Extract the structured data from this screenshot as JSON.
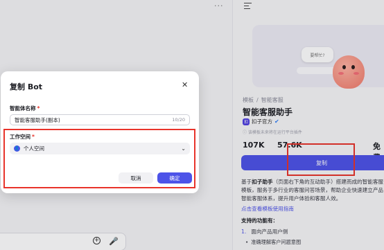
{
  "chat": {
    "more_icon": "more-horizontal-icon",
    "add_icon_label": "+",
    "mic_icon_label": "🎤"
  },
  "detail": {
    "preview_bubble": "要帮忙?",
    "breadcrumb": [
      "模板",
      "智能客服"
    ],
    "title": "智能客服助手",
    "author": "扣子官方",
    "author_logo": "扣",
    "notice": "该模板未来将在运行平台插件",
    "stats": [
      "107K",
      "57.6K",
      "免费"
    ],
    "copy_button": "复制",
    "description_prefix": "基于",
    "description_bold": "扣子助手",
    "description_rest": "（页面右下角的互动助手）搭建而成的智能客服模板，服务于多行业的客服问答场景，帮助企业快速建立产品智能客服体系，提升用户体验和客服人效。",
    "guide_link": "点击查看模板使用指南",
    "features_title": "支持的功能有：",
    "feature_1_num": "1.",
    "feature_1": "面向产品用户侧",
    "feature_1_sub": "准确理解客户问题意图"
  },
  "modal": {
    "title": "复制 Bot",
    "name_label": "智能体名称",
    "required_mark": "*",
    "name_value": "智能客服助手(副本)",
    "name_counter": "10/20",
    "workspace_label": "工作空间",
    "workspace_value": "个人空间",
    "cancel_button": "取消",
    "confirm_button": "确定"
  },
  "colors": {
    "accent": "#4d53e8",
    "highlight": "#e8332a"
  }
}
